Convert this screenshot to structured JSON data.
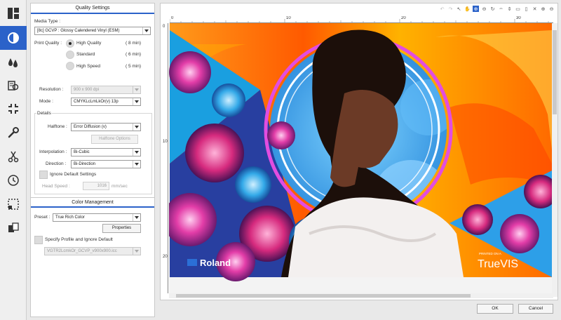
{
  "quality": {
    "section_title": "Quality Settings",
    "media_type_label": "Media Type :",
    "media_type_value": "[8c] GCVP : Glossy Calendered Vinyl (ESM)",
    "print_quality_label": "Print Quality :",
    "options": [
      {
        "label": "High Quality",
        "time": "( 8 min)",
        "selected": true
      },
      {
        "label": "Standard",
        "time": "( 6 min)",
        "selected": false
      },
      {
        "label": "High Speed",
        "time": "( 5 min)",
        "selected": false
      }
    ],
    "resolution_label": "Resolution :",
    "resolution_value": "900 x 900 dpi",
    "mode_label": "Mode :",
    "mode_value": "CMYKLcLmLkOr(v) 13p",
    "details_label": "Details",
    "halftone_label": "Halftone :",
    "halftone_value": "Error Diffusion (v)",
    "halftone_options_label": "Halftone Options",
    "interpolation_label": "Interpolation :",
    "interpolation_value": "Bi-Cubic",
    "direction_label": "Direction :",
    "direction_value": "Bi-Direction",
    "ignore_default_label": "Ignore Default Settings",
    "head_speed_label": "Head Speed :",
    "head_speed_value": "1016",
    "head_speed_unit": "mm/sec"
  },
  "color": {
    "section_title": "Color Management",
    "preset_label": "Preset :",
    "preset_value": "True Rich Color",
    "properties_label": "Properties",
    "specify_profile_label": "Specify Profile and Ignore Default",
    "profile_value": "VGTR2LcmkOr_GCVP_v900x900.icc"
  },
  "ruler": {
    "h_ticks": [
      "0",
      "10",
      "20",
      "30"
    ],
    "v_ticks": [
      "0",
      "10",
      "20"
    ]
  },
  "preview": {
    "brand_left": "Roland",
    "printed_on": "PRINTED ON A",
    "brand_right": "TrueVIS"
  },
  "footer": {
    "ok_label": "OK",
    "cancel_label": "Cancel"
  },
  "colors": {
    "accent": "#2b62c9"
  }
}
